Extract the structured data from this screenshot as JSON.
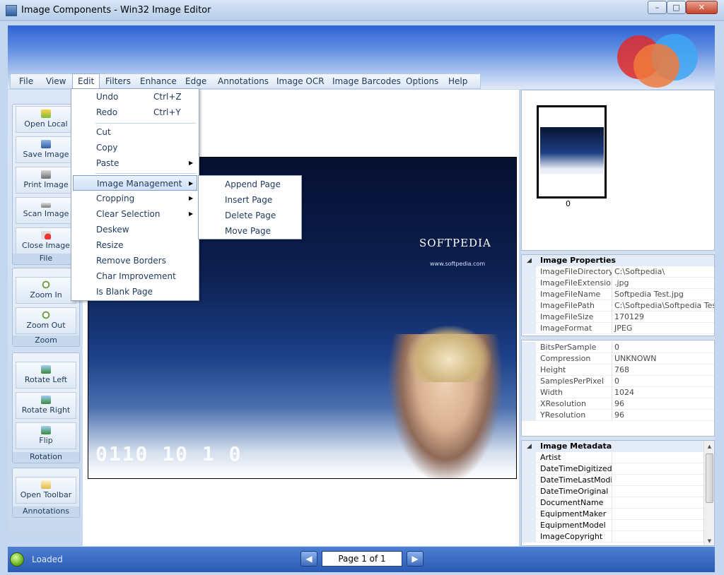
{
  "window": {
    "title": "Image Components - Win32 Image Editor",
    "controls": {
      "minimize": "–",
      "maximize": "□",
      "close": "✕"
    }
  },
  "menubar": [
    "File",
    "View",
    "Edit",
    "Filters",
    "Enhance",
    "Edge",
    "Annotations",
    "Image OCR",
    "Image Barcodes",
    "Options",
    "Help"
  ],
  "edit_menu": {
    "undo": {
      "label": "Undo",
      "shortcut": "Ctrl+Z"
    },
    "redo": {
      "label": "Redo",
      "shortcut": "Ctrl+Y"
    },
    "cut": "Cut",
    "copy": "Copy",
    "paste": "Paste",
    "image_management": "Image Management",
    "cropping": "Cropping",
    "clear_selection": "Clear Selection",
    "deskew": "Deskew",
    "resize": "Resize",
    "remove_borders": "Remove Borders",
    "char_improvement": "Char Improvement",
    "is_blank_page": "Is Blank Page"
  },
  "image_management_menu": [
    "Append Page",
    "Insert Page",
    "Delete Page",
    "Move Page"
  ],
  "toolbar": {
    "file": {
      "group": "File",
      "buttons": [
        "Open Local",
        "Save Image",
        "Print Image",
        "Scan Image",
        "Close Image"
      ]
    },
    "zoom": {
      "group": "Zoom",
      "buttons": [
        "Zoom In",
        "Zoom Out"
      ]
    },
    "rotation": {
      "group": "Rotation",
      "buttons": [
        "Rotate Left",
        "Rotate Right",
        "Flip"
      ]
    },
    "annotations": {
      "group": "Annotations",
      "buttons": [
        "Open Toolbar"
      ]
    }
  },
  "image": {
    "brand": "SOFTPEDIA",
    "url": "www.softpedia.com",
    "digits": "0110 10 1 0"
  },
  "thumbnail": {
    "caption": "0"
  },
  "image_properties": {
    "header": "Image Properties",
    "rows": [
      {
        "k": "ImageFileDirectory",
        "v": "C:\\Softpedia\\"
      },
      {
        "k": "ImageFileExtension",
        "v": ".jpg"
      },
      {
        "k": "ImageFileName",
        "v": "Softpedia Test.jpg"
      },
      {
        "k": "ImageFilePath",
        "v": "C:\\Softpedia\\Softpedia Test.jpg"
      },
      {
        "k": "ImageFileSize",
        "v": "170129"
      },
      {
        "k": "ImageFormat",
        "v": "JPEG"
      }
    ]
  },
  "image_details": {
    "rows": [
      {
        "k": "BitsPerSample",
        "v": "0"
      },
      {
        "k": "Compression",
        "v": "UNKNOWN"
      },
      {
        "k": "Height",
        "v": "768"
      },
      {
        "k": "SamplesPerPixel",
        "v": "0"
      },
      {
        "k": "Width",
        "v": "1024"
      },
      {
        "k": "XResolution",
        "v": "96"
      },
      {
        "k": "YResolution",
        "v": "96"
      }
    ]
  },
  "image_metadata": {
    "header": "Image Metadata",
    "rows": [
      "Artist",
      "DateTimeDigitized",
      "DateTimeLastModified",
      "DateTimeOriginal",
      "DocumentName",
      "EquipmentMaker",
      "EquipmentModel",
      "ImageCopyright"
    ]
  },
  "status": {
    "text": "Loaded",
    "page": "Page 1 of 1",
    "prev": "◀",
    "next": "▶"
  },
  "colors": {
    "accent": "#2a5bb4",
    "menu_highlight": "#cfe0f6",
    "frame": "#c4d7ee"
  }
}
